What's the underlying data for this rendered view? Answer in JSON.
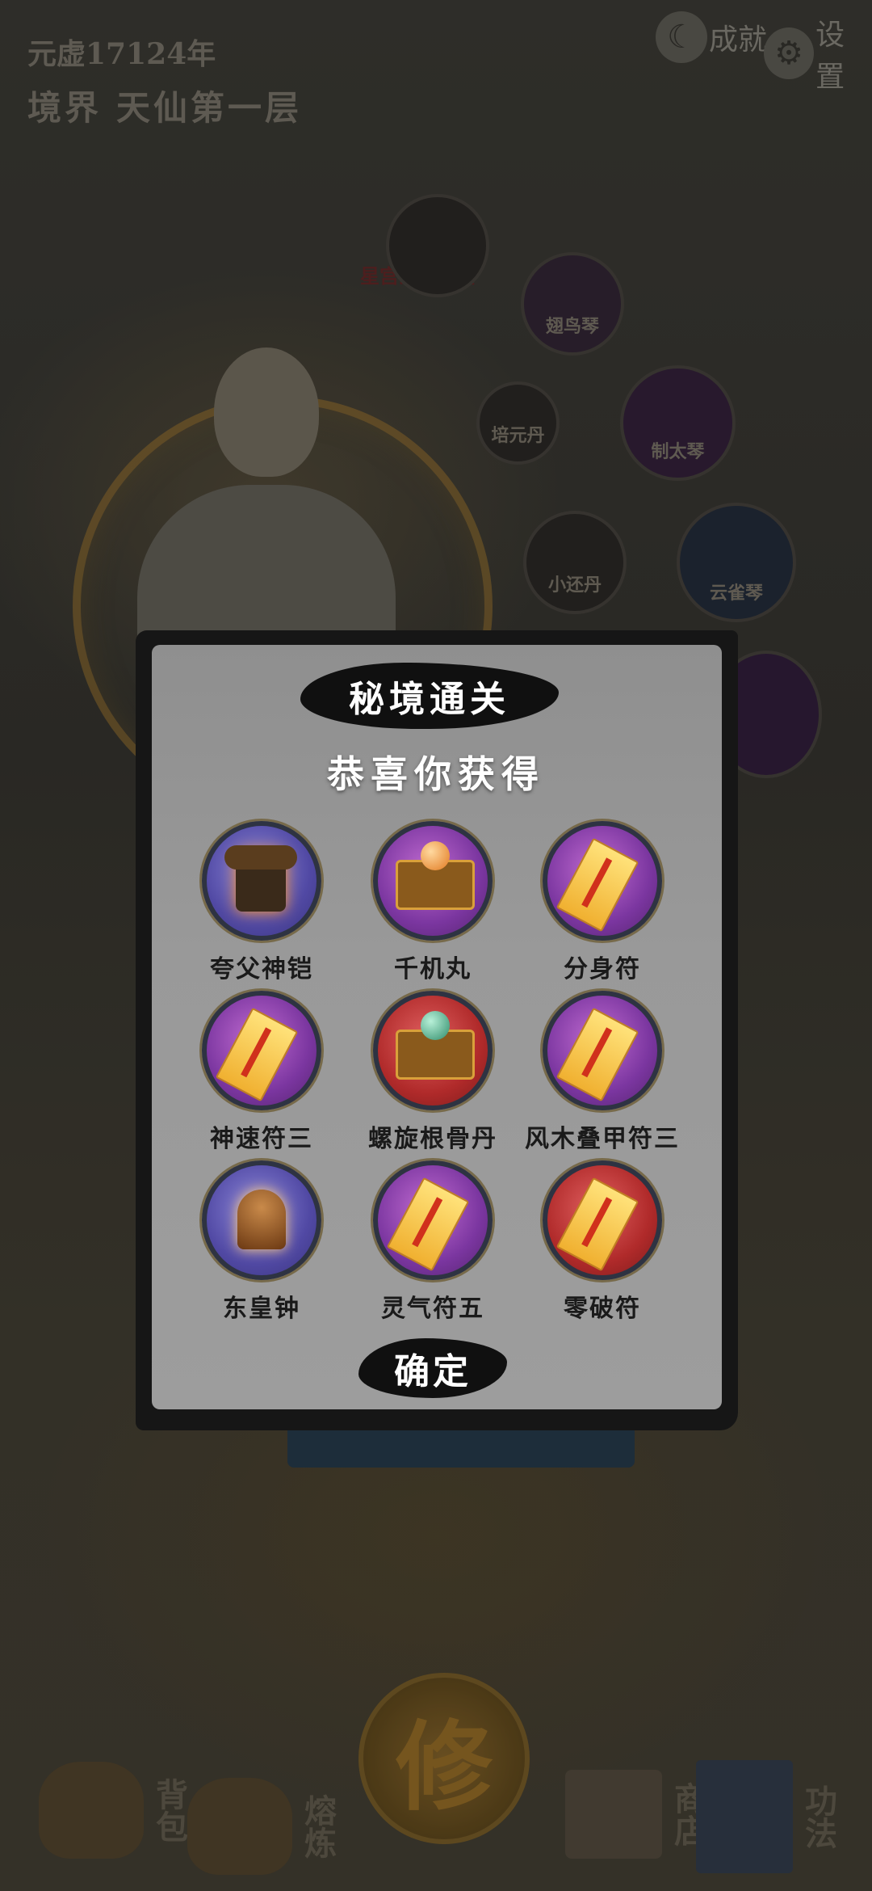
{
  "header": {
    "year": "元虚17124年",
    "realm_label": "境界",
    "realm_value": "天仙第一层",
    "achievements_label": "成就",
    "settings_label": "设置"
  },
  "skills": [
    {
      "label": "星宫剑法手套"
    },
    {
      "label": "翅鸟琴"
    },
    {
      "label": "培元丹"
    },
    {
      "label": "制太琴"
    },
    {
      "label": "小还丹"
    },
    {
      "label": "云雀琴"
    }
  ],
  "popup": {
    "title": "秘境通关",
    "message": "恭喜你获得",
    "confirm_label": "确定",
    "rewards": [
      {
        "name": "夸父神铠",
        "icon": "armor-icon",
        "frame": "blue"
      },
      {
        "name": "千机丸",
        "icon": "treasure-chest-icon",
        "frame": "purple"
      },
      {
        "name": "分身符",
        "icon": "talisman-icon",
        "frame": "purple"
      },
      {
        "name": "神速符三",
        "icon": "talisman-icon",
        "frame": "purple"
      },
      {
        "name": "螺旋根骨丹",
        "icon": "treasure-chest-icon",
        "frame": "red"
      },
      {
        "name": "风木叠甲符三",
        "icon": "talisman-icon",
        "frame": "purple"
      },
      {
        "name": "东皇钟",
        "icon": "bell-icon",
        "frame": "blue"
      },
      {
        "name": "灵气符五",
        "icon": "talisman-icon",
        "frame": "purple"
      },
      {
        "name": "零破符",
        "icon": "talisman-icon",
        "frame": "red"
      }
    ]
  },
  "bottom_nav": {
    "bag": "背包",
    "melt": "熔炼",
    "cultivate": "修",
    "shop": "商店",
    "skills": "功法"
  }
}
